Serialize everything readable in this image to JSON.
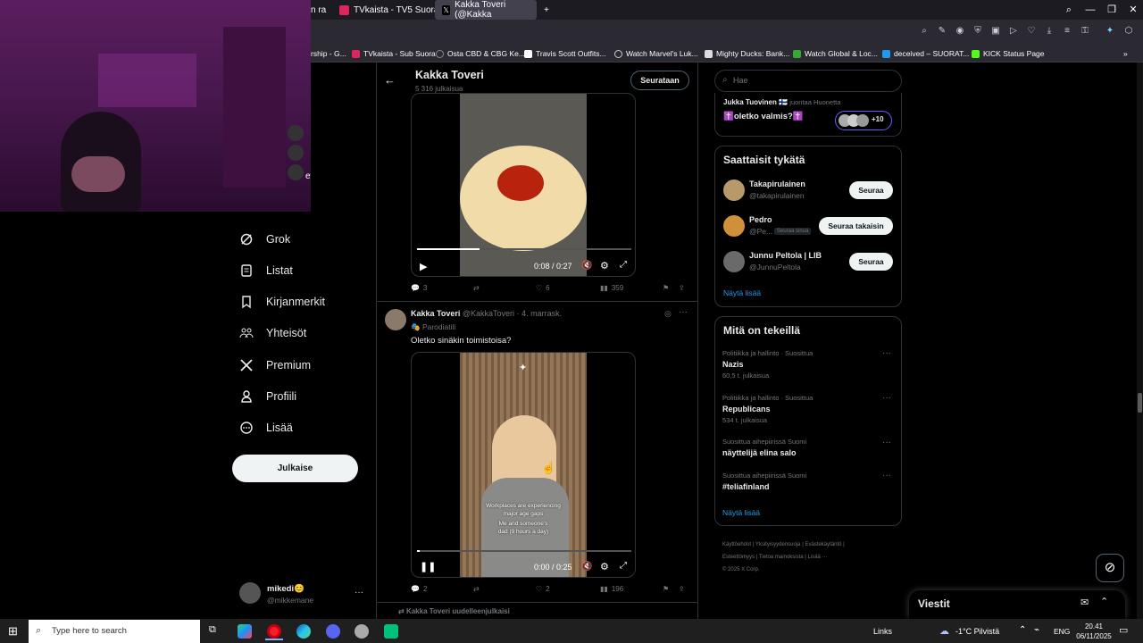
{
  "browser": {
    "tabs": [
      {
        "label": "n ra"
      },
      {
        "label": "TVkaista - TV5 Suora"
      },
      {
        "label": "Kakka Toveri (@Kakka"
      }
    ],
    "bookmarks": [
      "rship - G...",
      "TVkaista - Sub Suora",
      "Osta CBD & CBG Ke...",
      "Travis Scott Outfits...",
      "Watch Marvel's Luk...",
      "Mighty Ducks: Bank...",
      "Watch Global & Loc...",
      "deceived – SUORAT...",
      "KICK Status Page"
    ]
  },
  "webcam": {
    "overlay_text": "et"
  },
  "sidebar": {
    "items": [
      {
        "label": "Grok",
        "icon": "grok-icon"
      },
      {
        "label": "Listat",
        "icon": "list-icon"
      },
      {
        "label": "Kirjanmerkit",
        "icon": "bookmark-icon"
      },
      {
        "label": "Yhteisöt",
        "icon": "communities-icon"
      },
      {
        "label": "Premium",
        "icon": "x-logo-icon"
      },
      {
        "label": "Profiili",
        "icon": "profile-icon"
      },
      {
        "label": "Lisää",
        "icon": "more-icon"
      }
    ],
    "post_button": "Julkaise",
    "account": {
      "name": "mikedi😊",
      "handle": "@mikkemane",
      "more": "···"
    }
  },
  "profile_header": {
    "name": "Kakka Toveri",
    "posts": "5 316 julkaisua",
    "follow_button": "Seurataan"
  },
  "posts": [
    {
      "video_time": "0:08 / 0:27",
      "replies": "3",
      "likes": "6",
      "views": "359"
    },
    {
      "author": "Kakka Toveri",
      "handle": "@KakkaToveri",
      "date": "· 4. marrask.",
      "badge": "Parodiatili",
      "text": "Oletko sinäkin toimistoisa?",
      "video_time": "0:00 / 0:25",
      "caption_line1": "Workplaces are experiencing",
      "caption_line2": "major age gaps",
      "caption_line3": "Me and someone's",
      "caption_line4": "dad (9 hours a day)",
      "replies": "2",
      "likes": "2",
      "views": "196"
    }
  ],
  "repost_notice": "Kakka Toveri uudelleenjulkaisi",
  "search": {
    "placeholder": "Hae"
  },
  "space": {
    "host": "Jukka Tuovinen 🇫🇮",
    "status": "juontaa Huonetta",
    "title": "✝️oletko valmis?✝️",
    "count": "+10"
  },
  "who_to_follow": {
    "title": "Saattaisit tykätä",
    "users": [
      {
        "name": "Takapirulainen",
        "handle": "@takapirulainen",
        "button": "Seuraa"
      },
      {
        "name": "Pedro",
        "handle": "@Pe...",
        "tag": "Seuraa sinua",
        "button": "Seuraa takaisin"
      },
      {
        "name": "Junnu Peltola | LIB",
        "handle": "@JunnuPeltola",
        "button": "Seuraa"
      }
    ],
    "show_more": "Näytä lisää"
  },
  "trends": {
    "title": "Mitä on tekeillä",
    "items": [
      {
        "context": "Politiikka ja hallinto · Suosittua",
        "name": "Nazis",
        "count": "60,5 t. julkaisua"
      },
      {
        "context": "Politiikka ja hallinto · Suosittua",
        "name": "Republicans",
        "count": "534 t. julkaisua"
      },
      {
        "context": "Suosittua aihepiirissä Suomi",
        "name": "näyttelijä elina salo",
        "count": ""
      },
      {
        "context": "Suosittua aihepiirissä Suomi",
        "name": "#teliafinland",
        "count": ""
      }
    ],
    "show_more": "Näytä lisää"
  },
  "footer": {
    "links": [
      "Käyttöehdot",
      "Yksityisyydensuoja",
      "Evästekäytäntö",
      "Esteettömyys",
      "Tietoa mainoksista",
      "Lisää ···"
    ],
    "copyright": "© 2025 X Corp."
  },
  "messages": {
    "title": "Viestit"
  },
  "taskbar": {
    "search_placeholder": "Type here to search",
    "links": "Links",
    "weather": "-1°C  Pilvistä",
    "lang": "ENG",
    "time": "20.41",
    "date": "06/11/2025"
  }
}
